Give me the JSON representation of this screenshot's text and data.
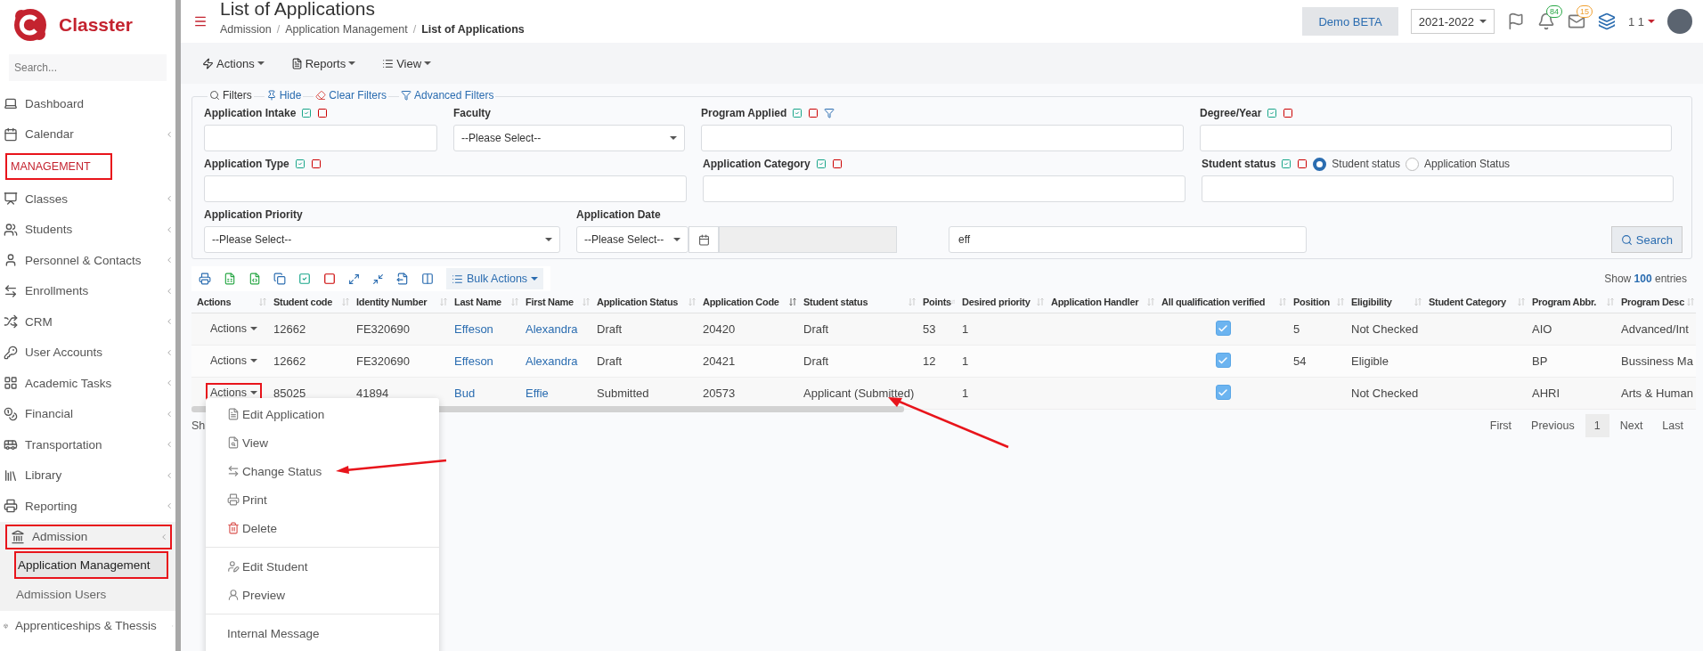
{
  "sidebar": {
    "brand": "Classter",
    "search": {
      "placeholder": "Search..."
    },
    "items": [
      {
        "kind": "item",
        "label": "Dashboard",
        "submenu": false,
        "highlighted": false
      },
      {
        "kind": "item",
        "label": "Calendar",
        "submenu": true,
        "highlighted": false
      },
      {
        "kind": "heading",
        "label": "MANAGEMENT",
        "highlighted": true
      },
      {
        "kind": "item",
        "label": "Classes",
        "submenu": true,
        "highlighted": false
      },
      {
        "kind": "item",
        "label": "Students",
        "submenu": true,
        "highlighted": false
      },
      {
        "kind": "item",
        "label": "Personnel & Contacts",
        "submenu": true,
        "highlighted": false
      },
      {
        "kind": "item",
        "label": "Enrollments",
        "submenu": true,
        "highlighted": false
      },
      {
        "kind": "item",
        "label": "CRM",
        "submenu": true,
        "highlighted": false
      },
      {
        "kind": "item",
        "label": "User Accounts",
        "submenu": true,
        "highlighted": false
      },
      {
        "kind": "item",
        "label": "Academic Tasks",
        "submenu": true,
        "highlighted": false
      },
      {
        "kind": "item",
        "label": "Financial",
        "submenu": true,
        "highlighted": false
      },
      {
        "kind": "item",
        "label": "Transportation",
        "submenu": true,
        "highlighted": false
      },
      {
        "kind": "item",
        "label": "Library",
        "submenu": true,
        "highlighted": false
      },
      {
        "kind": "item",
        "label": "Reporting",
        "submenu": true,
        "highlighted": false
      },
      {
        "kind": "item",
        "label": "Admission",
        "submenu": true,
        "highlighted": true,
        "expanded": true,
        "children": [
          {
            "label": "Application Management",
            "selected": true,
            "highlighted": true
          },
          {
            "label": "Admission Users",
            "selected": false,
            "highlighted": false
          }
        ]
      },
      {
        "kind": "item",
        "label": "Apprenticeships & Thessis",
        "submenu": true,
        "highlighted": false
      }
    ]
  },
  "header": {
    "title": "List of Applications",
    "breadcrumb": [
      {
        "kind": "link",
        "label": "Admission"
      },
      {
        "kind": "separator",
        "label": "/"
      },
      {
        "kind": "link",
        "label": "Application Management"
      },
      {
        "kind": "separator",
        "label": "/"
      },
      {
        "kind": "current",
        "label": "List of Applications"
      }
    ],
    "demo_button": "Demo BETA",
    "year": "2021-2022",
    "notifications": "84",
    "messages": "15",
    "user": "1 1"
  },
  "toolbar": [
    "Actions",
    "Reports",
    "View"
  ],
  "filters": {
    "links": [
      "Filters",
      "Hide",
      "Clear Filters",
      "Advanced Filters"
    ],
    "rows": [
      [
        {
          "kind": "text",
          "label": "Application Intake",
          "toggles": true
        },
        {
          "kind": "select",
          "label": "Faculty",
          "toggles": false,
          "value": "--Please Select--"
        },
        {
          "kind": "text",
          "label": "Program Applied",
          "toggles": true,
          "funnel": true
        },
        {
          "kind": "text",
          "label": "Degree/Year",
          "toggles": true
        }
      ],
      [
        {
          "kind": "text",
          "label": "Application Type",
          "toggles": true
        },
        {
          "kind": "text",
          "label": "Application Category",
          "toggles": true
        },
        {
          "kind": "text",
          "label": "Student status",
          "toggles": true,
          "options": [
            {
              "label": "Student status",
              "selected": true
            },
            {
              "label": "Application Status",
              "selected": false
            }
          ]
        }
      ],
      [
        {
          "kind": "select",
          "label": "Application Priority",
          "toggles": false,
          "value": "--Please Select--"
        },
        {
          "kind": "date",
          "label": "Application Date",
          "toggles": false,
          "value": "--Please Select--"
        },
        {
          "kind": "plain",
          "value": "eff"
        },
        {
          "kind": "button",
          "label": "Search"
        }
      ]
    ]
  },
  "table": {
    "bulk_actions": "Bulk Actions",
    "show": {
      "prefix": "Show",
      "count": "100",
      "suffix": "entries"
    },
    "columns": [
      {
        "label": "Actions",
        "kind": "action",
        "sorted": false
      },
      {
        "label": "Student code",
        "kind": "text",
        "sorted": false
      },
      {
        "label": "Identity Number",
        "kind": "text",
        "sorted": false
      },
      {
        "label": "Last Name",
        "kind": "link",
        "sorted": false
      },
      {
        "label": "First Name",
        "kind": "link",
        "sorted": false
      },
      {
        "label": "Application Status",
        "kind": "text",
        "sorted": false
      },
      {
        "label": "Application Code",
        "kind": "text",
        "sorted": true
      },
      {
        "label": "Student status",
        "kind": "text",
        "sorted": false
      },
      {
        "label": "Points",
        "kind": "text",
        "sorted": false
      },
      {
        "label": "Desired priority",
        "kind": "text",
        "sorted": false
      },
      {
        "label": "Application Handler",
        "kind": "text",
        "sorted": false
      },
      {
        "label": "All qualification verified",
        "kind": "check",
        "sorted": false
      },
      {
        "label": "Position",
        "kind": "text",
        "sorted": false
      },
      {
        "label": "Eligibility",
        "kind": "text",
        "sorted": false
      },
      {
        "label": "Student Category",
        "kind": "text",
        "sorted": false
      },
      {
        "label": "Program Abbr.",
        "kind": "text",
        "sorted": false
      },
      {
        "label": "Program Desc",
        "kind": "text",
        "sorted": false
      }
    ],
    "rows": [
      {
        "highlighted": false,
        "verified": true,
        "cells": [
          "Actions",
          "12662",
          "FE320690",
          "Effeson",
          "Alexandra",
          "Draft",
          "20420",
          "Draft",
          "53",
          "1",
          "",
          "",
          "5",
          "Not Checked",
          "",
          "AIO",
          "Advanced/Int"
        ]
      },
      {
        "highlighted": false,
        "verified": true,
        "cells": [
          "Actions",
          "12662",
          "FE320690",
          "Effeson",
          "Alexandra",
          "Draft",
          "20421",
          "Draft",
          "12",
          "1",
          "",
          "",
          "54",
          "Eligible",
          "",
          "BP",
          "Bussiness Ma"
        ]
      },
      {
        "highlighted": true,
        "verified": true,
        "cells": [
          "Actions",
          "85025",
          "41894",
          "Bud",
          "Effie",
          "Submitted",
          "20573",
          "Applicant (Submitted)",
          "",
          "1",
          "",
          "",
          "",
          "Not Checked",
          "",
          "AHRI",
          "Arts & Human"
        ]
      }
    ],
    "info": "Sh",
    "pagination": [
      {
        "label": "First",
        "selected": false
      },
      {
        "label": "Previous",
        "selected": false
      },
      {
        "label": "1",
        "selected": true
      },
      {
        "label": "Next",
        "selected": false
      },
      {
        "label": "Last",
        "selected": false
      }
    ]
  },
  "menu": {
    "groups": [
      [
        "Edit Application",
        "View",
        "Change Status",
        "Print",
        "Delete"
      ],
      [
        "Edit Student",
        "Preview"
      ],
      [
        "Internal Message"
      ]
    ]
  }
}
